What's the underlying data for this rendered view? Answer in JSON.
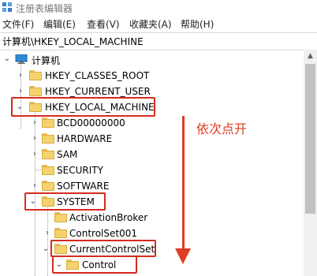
{
  "window": {
    "title": "注册表编辑器"
  },
  "menu": [
    "文件(F)",
    "编辑(E)",
    "查看(V)",
    "收藏夹(A)",
    "帮助(H)"
  ],
  "address": "计算机\\HKEY_LOCAL_MACHINE",
  "tree": {
    "root": "计算机",
    "items": [
      {
        "label": "HKEY_CLASSES_ROOT"
      },
      {
        "label": "HKEY_CURRENT_USER"
      },
      {
        "label": "HKEY_LOCAL_MACHINE"
      },
      {
        "label": "BCD00000000"
      },
      {
        "label": "HARDWARE"
      },
      {
        "label": "SAM"
      },
      {
        "label": "SECURITY"
      },
      {
        "label": "SOFTWARE"
      },
      {
        "label": "SYSTEM"
      },
      {
        "label": "ActivationBroker"
      },
      {
        "label": "ControlSet001"
      },
      {
        "label": "CurrentControlSet"
      },
      {
        "label": "Control"
      }
    ]
  },
  "annotation": {
    "text": "依次点开",
    "color": "#e03b24"
  },
  "colors": {
    "highlight": "#d62b1e",
    "folder": "#f4d26e",
    "scroll_thumb": "#c1c1c1"
  }
}
